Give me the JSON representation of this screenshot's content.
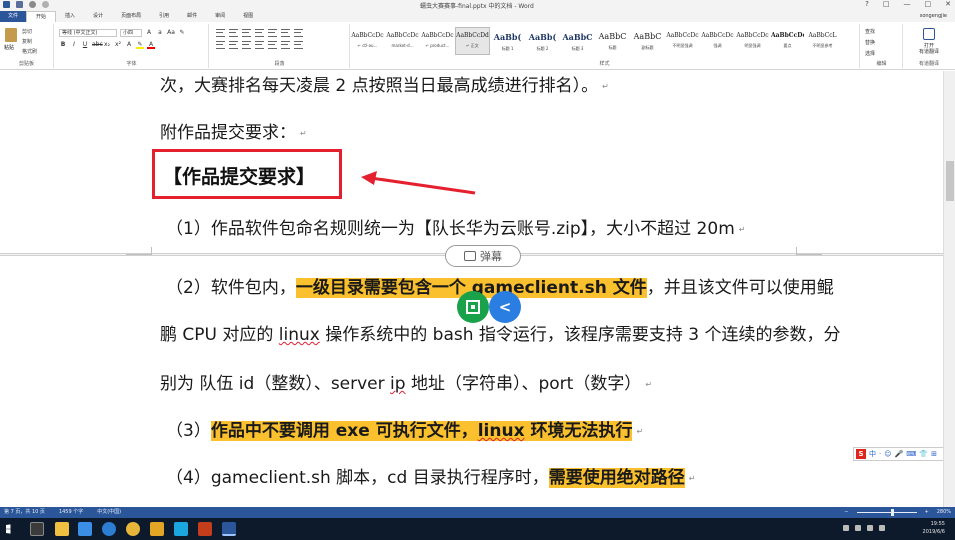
{
  "window": {
    "title": "蠕虫大赛赛事-final.pptx 中的文档 - Word",
    "controls": [
      "?",
      "□",
      "—",
      "□",
      "✕"
    ]
  },
  "ribbon_tabs": [
    "文件",
    "开始",
    "插入",
    "设计",
    "页面布局",
    "引用",
    "邮件",
    "审阅",
    "视图"
  ],
  "active_tab": "开始",
  "user_name": "songengjie",
  "clipboard": {
    "paste_label": "粘贴",
    "items": [
      "剪切",
      "复制",
      "格式刷"
    ],
    "group_label": "剪贴板"
  },
  "font": {
    "font_name": "等线 (中文正文)",
    "font_size": "小四",
    "group_label": "字体"
  },
  "paragraph": {
    "group_label": "段落"
  },
  "styles": {
    "group_label": "样式",
    "items": [
      {
        "preview": "AaBbCcDc",
        "name": "↵ ctl-ou..."
      },
      {
        "preview": "AaBbCcDc",
        "name": "market-d..."
      },
      {
        "preview": "AaBbCcDc",
        "name": "↵ product..."
      },
      {
        "preview": "AaBbCcDd",
        "name": "↵ 正文"
      },
      {
        "preview": "AaBb(",
        "name": "标题 1"
      },
      {
        "preview": "AaBb(",
        "name": "标题 2"
      },
      {
        "preview": "AaBbC",
        "name": "标题 3"
      },
      {
        "preview": "AaBbC",
        "name": "标题"
      },
      {
        "preview": "AaBbC",
        "name": "副标题"
      },
      {
        "preview": "AaBbCcDc",
        "name": "不明显强调"
      },
      {
        "preview": "AaBbCcDc",
        "name": "强调"
      },
      {
        "preview": "AaBbCcDc",
        "name": "明显强调"
      },
      {
        "preview": "AaBbCcDc",
        "name": "要点"
      },
      {
        "preview": "AaBbCcL",
        "name": "不明显参考"
      }
    ],
    "selected_index": 3
  },
  "editing": {
    "items": [
      "查找",
      "替换",
      "选择"
    ],
    "group_label": "编辑"
  },
  "share": {
    "label_line1": "打开",
    "label_line2": "有道翻译",
    "group_label": "有道翻译"
  },
  "document": {
    "line1": "次，大赛排名每天凌晨 2 点按照当日最高成绩进行排名）。",
    "line2": "附作品提交要求：",
    "heading": "【作品提交要求】",
    "item1": "（1）作品软件包命名规则统一为【队长华为云账号.zip】，大小不超过 20m",
    "item2_pre": "（2）软件包内，",
    "item2_hl": "一级目录需要包含一个 gameclient.sh 文件",
    "item2_post": "，并且该文件可以使用鲲",
    "item2_line2_a": "鹏 CPU 对应的 ",
    "item2_line2_linux": "linux",
    "item2_line2_b": " 操作系统中的 bash 指令运行，该程序需要支持 3 个连续的参数，分",
    "item2_line3_a": "别为  队伍 id（整数）、server ",
    "item2_line3_ip": "ip",
    "item2_line3_b": " 地址（字符串）、port（数字）",
    "item3_pre": "（3）",
    "item3_hl_a": "作品中不要调用 exe 可执行文件，",
    "item3_hl_linux": "linux",
    "item3_hl_b": " 环境无法执行",
    "item4_pre": "（4）gameclient.sh 脚本，cd 目录执行程序时，",
    "item4_hl": "需要使用绝对路径",
    "paragraph_mark": "↵"
  },
  "overlay": {
    "danmu_label": "弹幕"
  },
  "ime": {
    "logo": "S",
    "items": [
      "中",
      "·",
      "☺",
      "🎤",
      "⌨",
      "👕",
      "⊞"
    ]
  },
  "status_bar": {
    "page": "第 7 页，共 10 页",
    "words": "1459 个字",
    "language": "中文(中国)",
    "zoom": "280%"
  },
  "taskbar": {
    "time": "19:55",
    "date": "2019/6/6",
    "apps": [
      {
        "name": "explorer",
        "color": "#f0c040"
      },
      {
        "name": "store",
        "color": "#3a8ee6"
      },
      {
        "name": "edge",
        "color": "#2d7dd2"
      },
      {
        "name": "chrome",
        "color": "#e8b73a"
      },
      {
        "name": "folder",
        "color": "#e3a526"
      },
      {
        "name": "video",
        "color": "#1ba6e0"
      },
      {
        "name": "powerpoint",
        "color": "#c43e1c"
      },
      {
        "name": "word",
        "color": "#2b579a"
      }
    ]
  },
  "colors": {
    "word_blue": "#2b579a",
    "highlight": "#fbc02d",
    "annotation_red": "#e5202e"
  }
}
